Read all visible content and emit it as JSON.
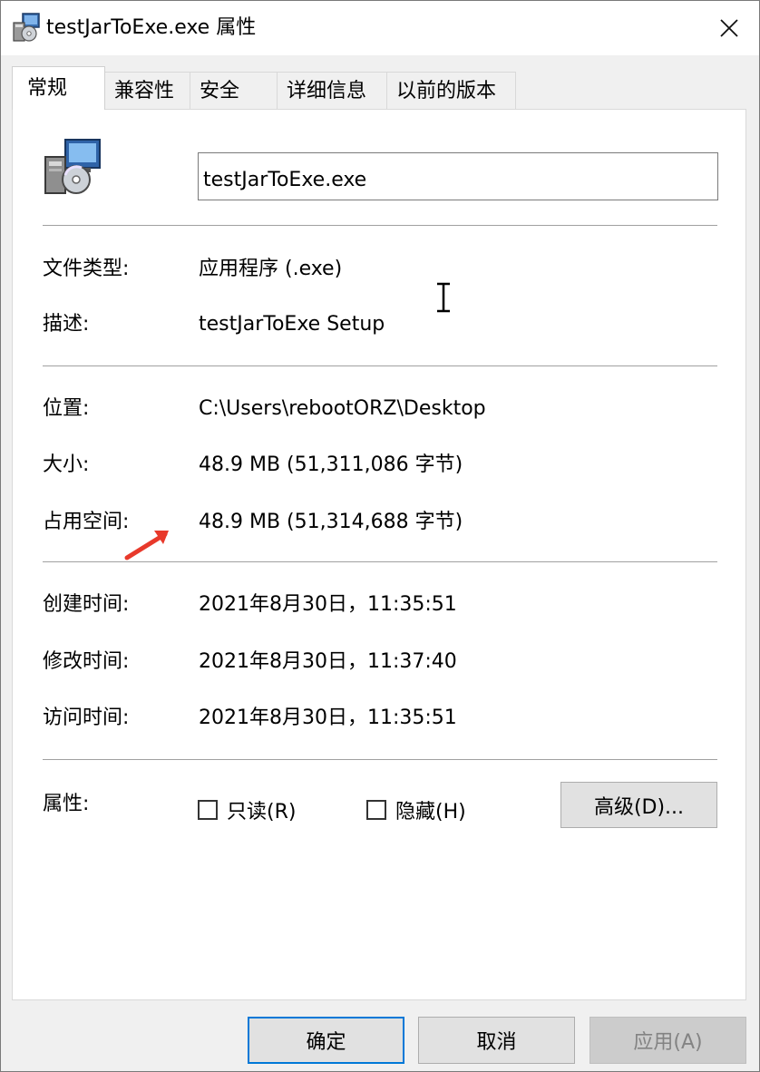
{
  "window": {
    "title": "testJarToExe.exe 属性",
    "app_icon": "exe-installer-icon",
    "close_icon": "close-icon"
  },
  "tabs": [
    {
      "label": "常规",
      "active": true
    },
    {
      "label": "兼容性",
      "active": false
    },
    {
      "label": "安全",
      "active": false
    },
    {
      "label": "详细信息",
      "active": false
    },
    {
      "label": "以前的版本",
      "active": false
    }
  ],
  "general": {
    "file_name": "testJarToExe.exe",
    "file_type_label": "文件类型:",
    "file_type_value": "应用程序 (.exe)",
    "description_label": "描述:",
    "description_value": "testJarToExe Setup",
    "location_label": "位置:",
    "location_value": "C:\\Users\\rebootORZ\\Desktop",
    "size_label": "大小:",
    "size_value": "48.9 MB (51,311,086 字节)",
    "size_on_disk_label": "占用空间:",
    "size_on_disk_value": "48.9 MB (51,314,688 字节)",
    "created_label": "创建时间:",
    "created_value": "2021年8月30日，11:35:51",
    "modified_label": "修改时间:",
    "modified_value": "2021年8月30日，11:37:40",
    "accessed_label": "访问时间:",
    "accessed_value": "2021年8月30日，11:35:51",
    "attributes_label": "属性:",
    "readonly_label": "只读(R)",
    "readonly_checked": false,
    "hidden_label": "隐藏(H)",
    "hidden_checked": false,
    "advanced_button": "高级(D)..."
  },
  "footer": {
    "ok": "确定",
    "cancel": "取消",
    "apply": "应用(A)",
    "apply_enabled": false
  },
  "annotation": {
    "arrow_color": "#e8392b"
  }
}
